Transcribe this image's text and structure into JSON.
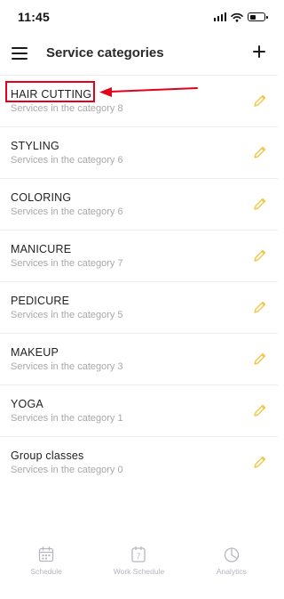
{
  "status_bar": {
    "time": "11:45"
  },
  "header": {
    "title": "Service categories"
  },
  "categories": [
    {
      "name": "HAIR CUTTING",
      "subtitle": "Services in the category 8"
    },
    {
      "name": "STYLING",
      "subtitle": "Services in the category 6"
    },
    {
      "name": "COLORING",
      "subtitle": "Services in the category 6"
    },
    {
      "name": "MANICURE",
      "subtitle": "Services in the category 7"
    },
    {
      "name": "PEDICURE",
      "subtitle": "Services in the category 5"
    },
    {
      "name": "MAKEUP",
      "subtitle": "Services in the category 3"
    },
    {
      "name": "YOGA",
      "subtitle": "Services in the category 1"
    },
    {
      "name": "Group classes",
      "subtitle": "Services in the category 0"
    }
  ],
  "tab_bar": {
    "items": [
      {
        "label": "Schedule",
        "icon": "calendar-icon"
      },
      {
        "label": "Work Schedule",
        "icon": "calendar-7-icon",
        "icon_text": "7"
      },
      {
        "label": "Analytics",
        "icon": "pie-chart-icon"
      }
    ]
  },
  "colors": {
    "accent_edit": "#f2c94c",
    "highlight": "#e3001b",
    "tab_inactive": "#b4b7bf"
  }
}
